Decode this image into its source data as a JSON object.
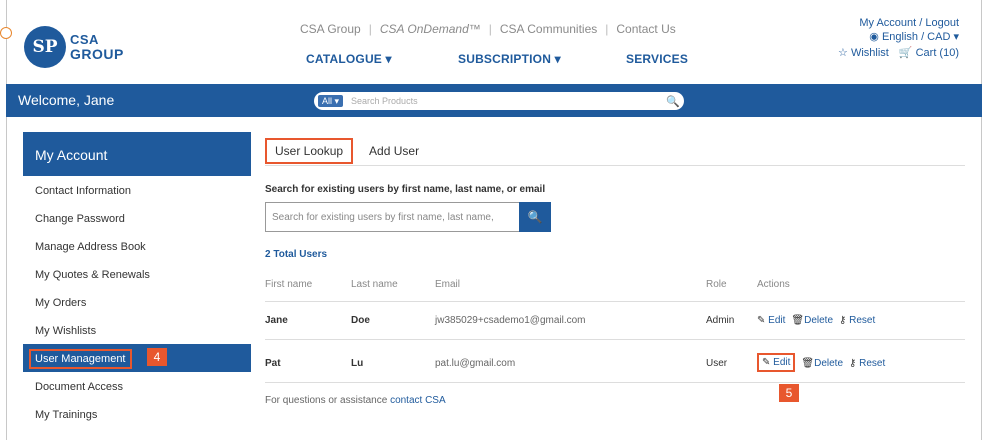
{
  "header": {
    "logo": {
      "line1": "CSA",
      "line2": "GROUP",
      "mark": "SP"
    },
    "topnav": [
      "CSA Group",
      "CSA OnDemand™",
      "CSA Communities",
      "Contact Us"
    ],
    "mainnav": [
      "CATALOGUE ▾",
      "SUBSCRIPTION ▾",
      "SERVICES"
    ],
    "account": {
      "links": "My Account / Logout",
      "lang": "English / CAD ▾",
      "wishlist": "Wishlist",
      "cart": "Cart (10)"
    }
  },
  "bar": {
    "welcome": "Welcome, Jane",
    "all": "All ▾",
    "search_placeholder": "Search Products"
  },
  "sidebar": {
    "title": "My Account",
    "items": [
      "Contact Information",
      "Change Password",
      "Manage Address Book",
      "My Quotes & Renewals",
      "My Orders",
      "My Wishlists",
      "User Management",
      "Document Access",
      "My Trainings"
    ],
    "active_badge": "4"
  },
  "main": {
    "tabs": [
      "User Lookup",
      "Add User"
    ],
    "search_label": "Search for existing users by first name, last name, or email",
    "search_placeholder": "Search for existing users by first name, last name,",
    "total": "2 Total Users",
    "columns": [
      "First name",
      "Last name",
      "Email",
      "Role",
      "Actions"
    ],
    "rows": [
      {
        "first": "Jane",
        "last": "Doe",
        "email": "jw385029+csademo1@gmail.com",
        "role": "Admin"
      },
      {
        "first": "Pat",
        "last": "Lu",
        "email": "pat.lu@gmail.com",
        "role": "User"
      }
    ],
    "actions": {
      "edit": "Edit",
      "delete": "Delete",
      "reset": "Reset"
    },
    "edit_badge": "5",
    "footer_text": "For questions or assistance",
    "footer_link": "contact CSA"
  },
  "colors": {
    "brand": "#1f5a9c",
    "highlight": "#e8572e"
  }
}
